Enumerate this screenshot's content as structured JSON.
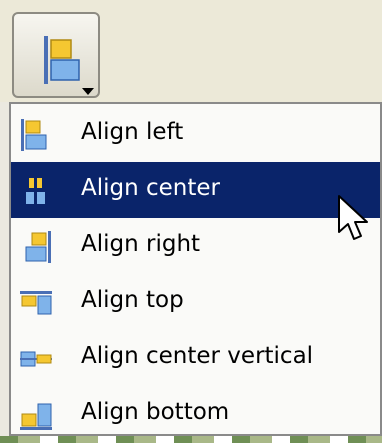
{
  "toolbar": {
    "align_button_icon": "align-left-icon",
    "dropdown_icon": "chevron-down-icon"
  },
  "menu": {
    "items": [
      {
        "label": "Align left",
        "icon": "align-left-icon",
        "highlighted": false
      },
      {
        "label": "Align center",
        "icon": "align-center-icon",
        "highlighted": true
      },
      {
        "label": "Align right",
        "icon": "align-right-icon",
        "highlighted": false
      },
      {
        "label": "Align top",
        "icon": "align-top-icon",
        "highlighted": false
      },
      {
        "label": "Align center vertical",
        "icon": "align-center-vertical-icon",
        "highlighted": false
      },
      {
        "label": "Align bottom",
        "icon": "align-bottom-icon",
        "highlighted": false
      }
    ]
  },
  "colors": {
    "highlight": "#0a246a",
    "icon_yellow": "#f5c731",
    "icon_blue": "#5a9be0",
    "icon_line": "#4a6fb5"
  }
}
